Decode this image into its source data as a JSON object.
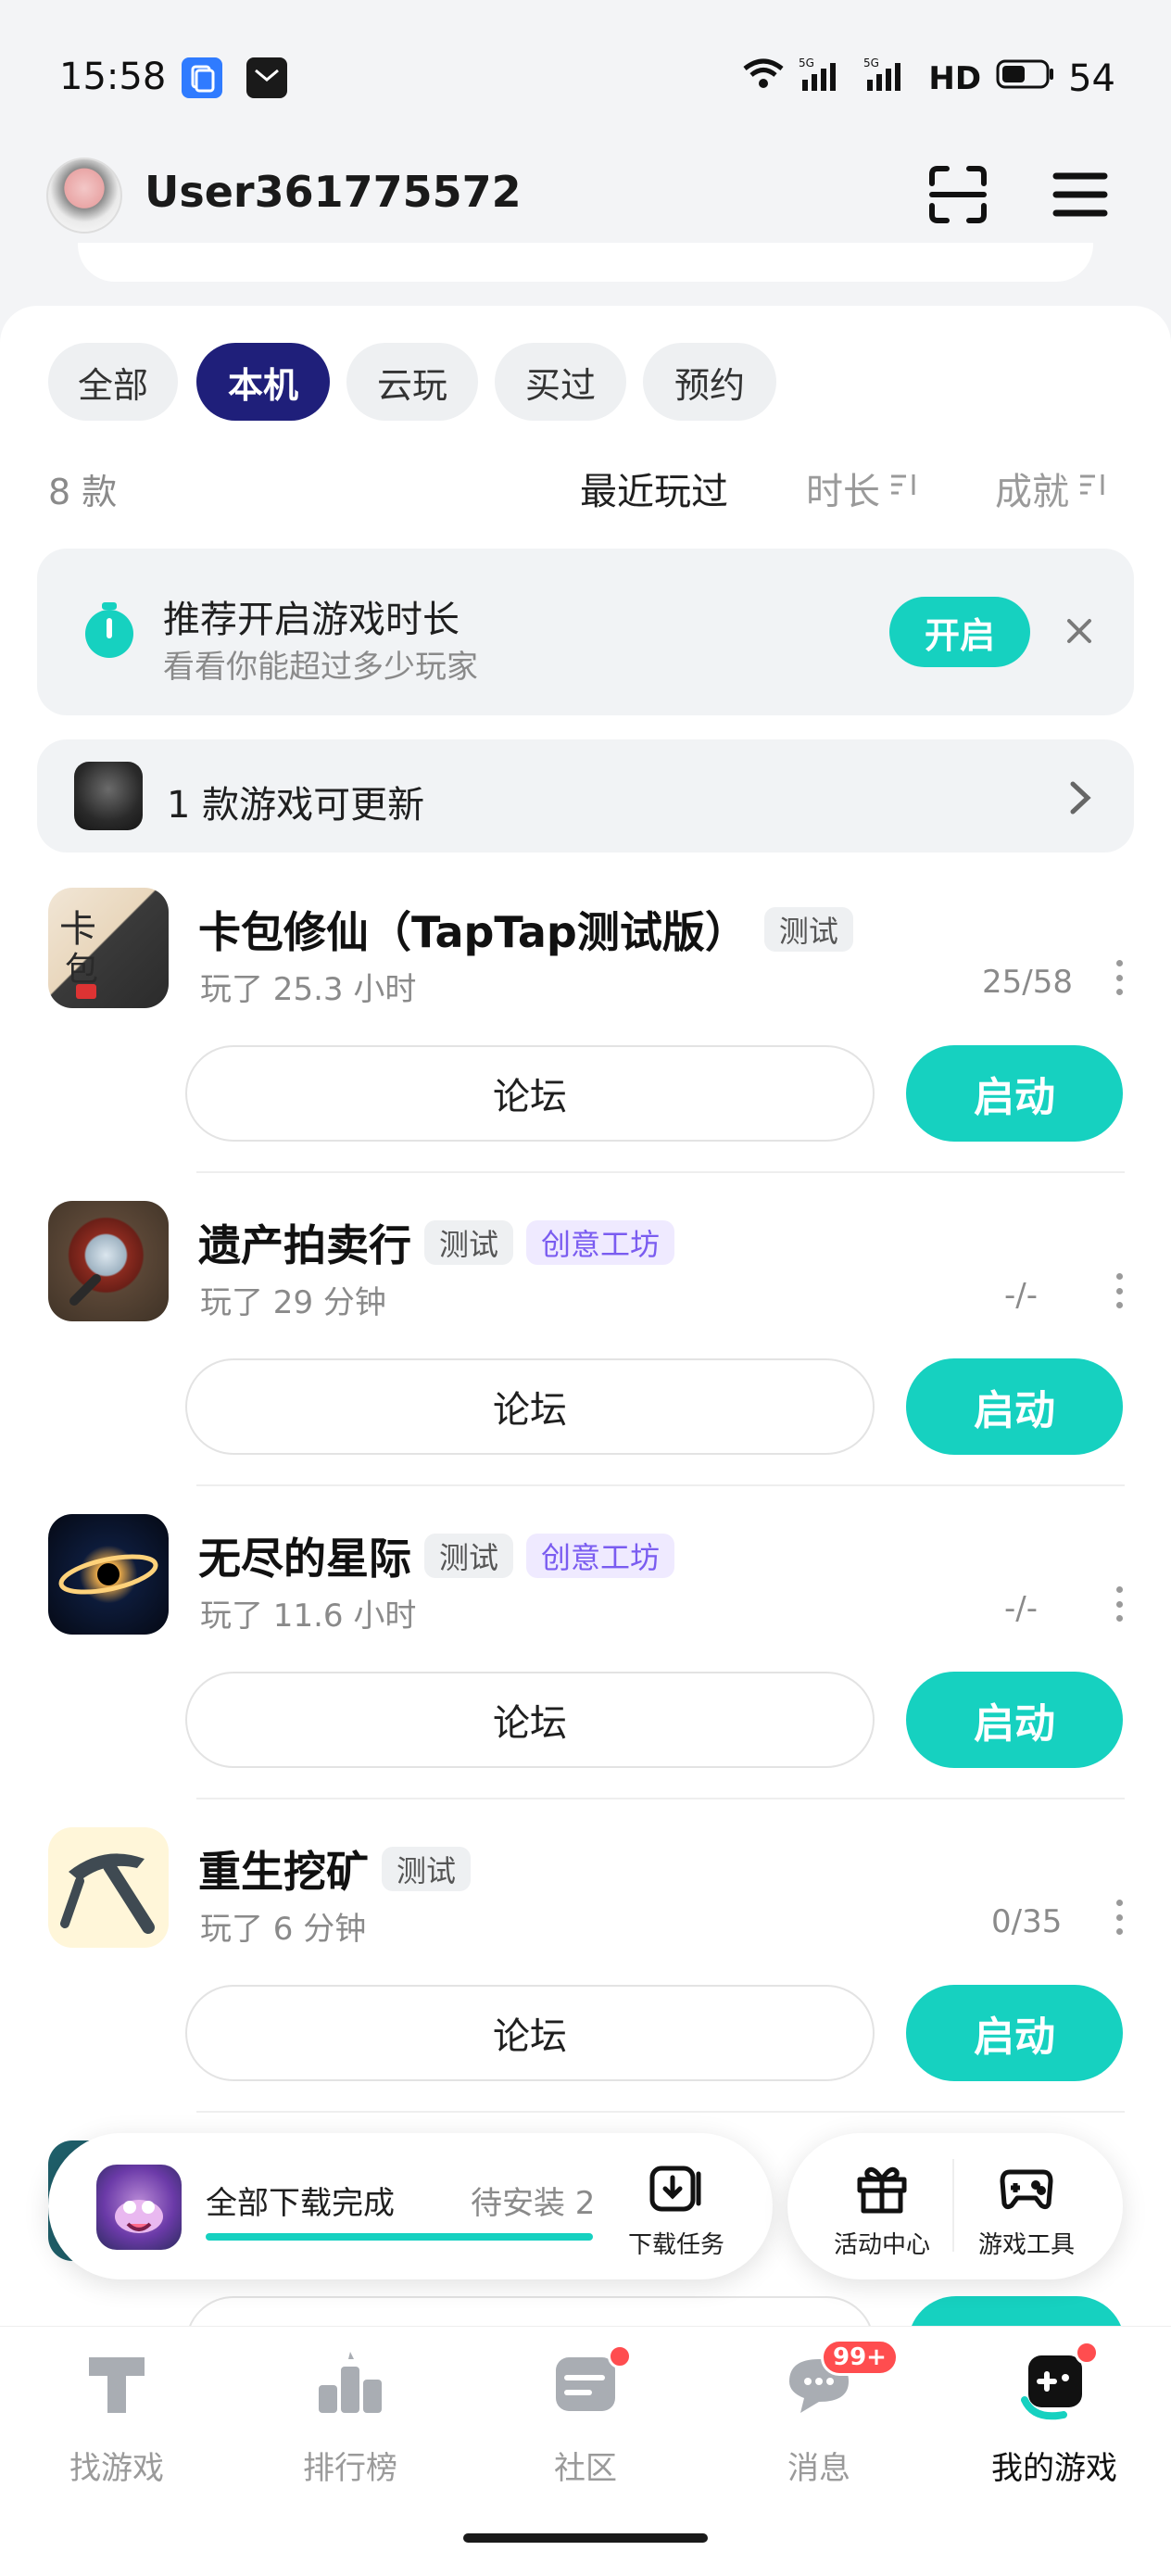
{
  "status_bar": {
    "time": "15:58",
    "network": "5G",
    "hd": "HD",
    "battery": "54"
  },
  "header": {
    "username": "User361775572"
  },
  "filters": {
    "chips": [
      {
        "label": "全部"
      },
      {
        "label": "本机"
      },
      {
        "label": "云玩"
      },
      {
        "label": "买过"
      },
      {
        "label": "预约"
      }
    ],
    "active_chip": "本机",
    "count": "8 款",
    "sorts": [
      {
        "label": "最近玩过"
      },
      {
        "label": "时长"
      },
      {
        "label": "成就"
      }
    ]
  },
  "banner": {
    "title": "推荐开启游戏时长",
    "subtitle": "看看你能超过多少玩家",
    "button": "开启"
  },
  "update_row": {
    "text": "1 款游戏可更新"
  },
  "games": [
    {
      "title": "卡包修仙（TapTap测试版）",
      "tags": [
        "测试"
      ],
      "played": "玩了 25.3 小时",
      "progress": "25/58",
      "forum": "论坛",
      "launch": "启动"
    },
    {
      "title": "遗产拍卖行",
      "tags": [
        "测试",
        "创意工坊"
      ],
      "played": "玩了 29 分钟",
      "progress": "-/-",
      "forum": "论坛",
      "launch": "启动"
    },
    {
      "title": "无尽的星际",
      "tags": [
        "测试",
        "创意工坊"
      ],
      "played": "玩了 11.6 小时",
      "progress": "-/-",
      "forum": "论坛",
      "launch": "启动"
    },
    {
      "title": "重生挖矿",
      "tags": [
        "测试"
      ],
      "played": "玩了 6 分钟",
      "progress": "0/35",
      "forum": "论坛",
      "launch": "启动"
    }
  ],
  "download_float": {
    "status": "全部下载完成",
    "pending": "待安装 2",
    "task_label": "下载任务",
    "progress": 1.0
  },
  "tools_float": {
    "activity": "活动中心",
    "tools": "游戏工具"
  },
  "bottom_nav": {
    "items": [
      {
        "label": "找游戏"
      },
      {
        "label": "排行榜"
      },
      {
        "label": "社区"
      },
      {
        "label": "消息"
      },
      {
        "label": "我的游戏"
      }
    ],
    "message_badge": "99+"
  },
  "colors": {
    "accent": "#16d1c0",
    "chip_active": "#1f1f7a",
    "badge": "#ff4d4f",
    "tag_purple": "#7a5cf0"
  }
}
